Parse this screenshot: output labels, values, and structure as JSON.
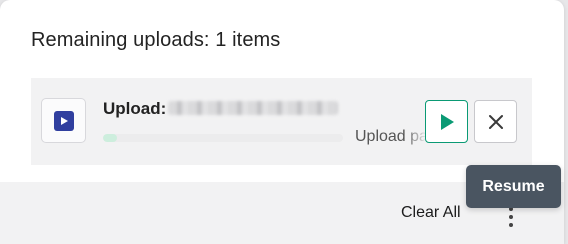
{
  "panel": {
    "title": "Remaining uploads: 1 items"
  },
  "upload": {
    "name_prefix": "Upload:",
    "status": "Upload paused",
    "progress_percent": 6,
    "file_icon": "video-file-icon"
  },
  "actions": {
    "resume_icon": "play-icon",
    "cancel_icon": "close-icon",
    "resume_tooltip": "Resume"
  },
  "footer": {
    "clear_all": "Clear All",
    "more_icon": "more-vertical-icon"
  },
  "colors": {
    "accent": "#0a9a74",
    "file_icon_bg": "#303f9f",
    "tooltip_bg": "#4a5561",
    "progress_fill": "#cdeedd"
  }
}
